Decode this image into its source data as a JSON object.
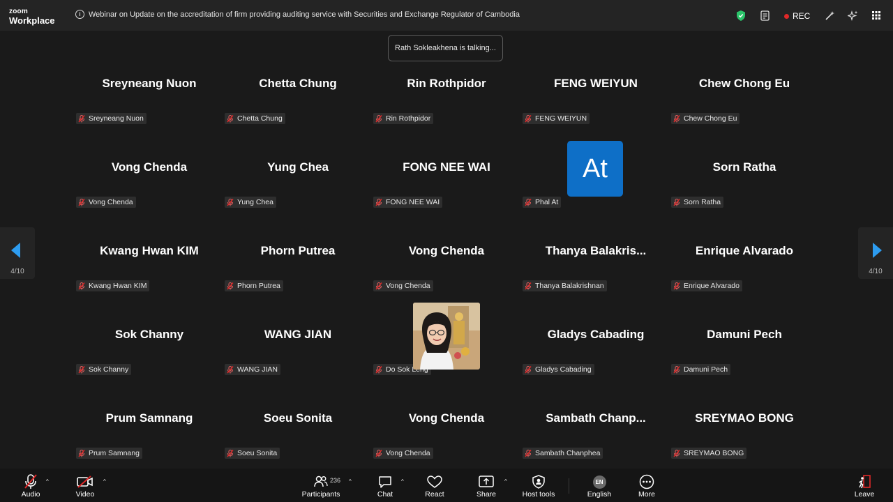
{
  "app": {
    "logo_line1": "zoom",
    "logo_line2": "Workplace",
    "meeting_title": "Webinar on Update on the accreditation of firm providing auditing service with Securities and Exchange Regulator of Cambodia",
    "rec_label": "REC"
  },
  "talking_indicator": "Rath Sokleakhena is talking...",
  "pager": {
    "left": "4/10",
    "right": "4/10"
  },
  "tiles": [
    {
      "name": "Sreyneang Nuon",
      "label": "Sreyneang Nuon"
    },
    {
      "name": "Chetta Chung",
      "label": "Chetta Chung"
    },
    {
      "name": "Rin Rothpidor",
      "label": "Rin Rothpidor"
    },
    {
      "name": "FENG WEIYUN",
      "label": "FENG WEIYUN"
    },
    {
      "name": "Chew Chong Eu",
      "label": "Chew Chong Eu"
    },
    {
      "name": "Vong Chenda",
      "label": "Vong Chenda"
    },
    {
      "name": "Yung Chea",
      "label": "Yung Chea"
    },
    {
      "name": "FONG NEE WAI",
      "label": "FONG NEE WAI"
    },
    {
      "name": "",
      "label": "Phal At",
      "avatar": "At"
    },
    {
      "name": "Sorn Ratha",
      "label": "Sorn Ratha"
    },
    {
      "name": "Kwang Hwan KIM",
      "label": "Kwang Hwan KIM"
    },
    {
      "name": "Phorn Putrea",
      "label": "Phorn Putrea"
    },
    {
      "name": "Vong Chenda",
      "label": "Vong Chenda"
    },
    {
      "name": "Thanya  Balakris...",
      "label": "Thanya Balakrishnan"
    },
    {
      "name": "Enrique Alvarado",
      "label": "Enrique Alvarado"
    },
    {
      "name": "Sok Channy",
      "label": "Sok Channy"
    },
    {
      "name": "WANG JIAN",
      "label": "WANG JIAN"
    },
    {
      "name": "",
      "label": "Do Sok Leng",
      "photo": true
    },
    {
      "name": "Gladys Cabading",
      "label": "Gladys Cabading"
    },
    {
      "name": "Damuni Pech",
      "label": "Damuni Pech"
    },
    {
      "name": "Prum Samnang",
      "label": "Prum Samnang"
    },
    {
      "name": "Soeu Sonita",
      "label": "Soeu Sonita"
    },
    {
      "name": "Vong Chenda",
      "label": "Vong Chenda"
    },
    {
      "name": "Sambath  Chanp...",
      "label": "Sambath Chanphea"
    },
    {
      "name": "SREYMAO BONG",
      "label": "SREYMAO BONG"
    }
  ],
  "toolbar": {
    "audio": "Audio",
    "video": "Video",
    "participants": "Participants",
    "participants_count": "236",
    "chat": "Chat",
    "react": "React",
    "share": "Share",
    "host_tools": "Host tools",
    "english": "English",
    "language_badge": "EN",
    "more": "More",
    "leave": "Leave"
  },
  "colors": {
    "background": "#1a1a1a",
    "avatar_bg": "#0e6fc7",
    "mute_red": "#e02828",
    "shield_green": "#2bc46a",
    "nav_arrow": "#2d9cf0"
  }
}
